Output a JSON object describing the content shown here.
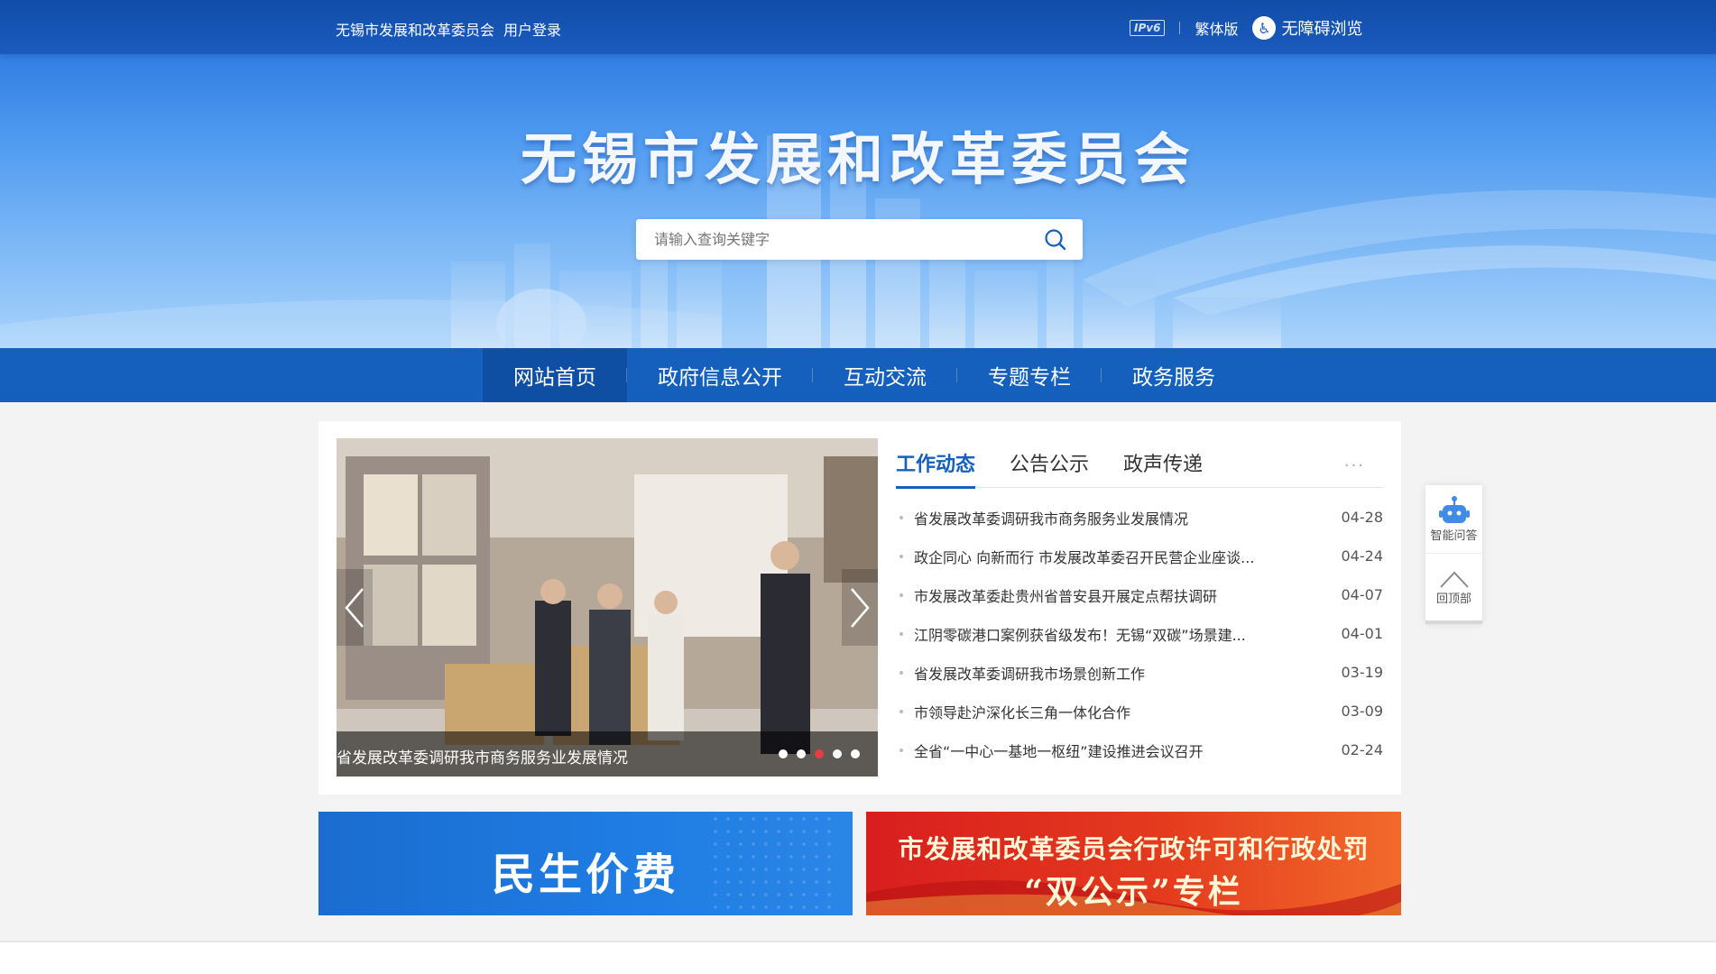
{
  "topbar": {
    "org_name": "无锡市发展和改革委员会",
    "login": "用户登录",
    "ipv6": "IPv6",
    "traditional": "繁体版",
    "accessibility": "无障碍浏览"
  },
  "header": {
    "site_title": "无锡市发展和改革委员会",
    "search_placeholder": "请输入查询关键字"
  },
  "nav": {
    "items": [
      {
        "label": "网站首页",
        "active": true
      },
      {
        "label": "政府信息公开"
      },
      {
        "label": "互动交流"
      },
      {
        "label": "专题专栏"
      },
      {
        "label": "政务服务"
      }
    ]
  },
  "carousel": {
    "caption": "省发展改革委调研我市商务服务业发展情况",
    "dots": 5,
    "active_dot": 3
  },
  "news": {
    "tabs": [
      {
        "label": "工作动态",
        "active": true
      },
      {
        "label": "公告公示"
      },
      {
        "label": "政声传递"
      }
    ],
    "more": "···",
    "items": [
      {
        "title": "省发展改革委调研我市商务服务业发展情况",
        "date": "04-28"
      },
      {
        "title": "政企同心 向新而行 市发展改革委召开民营企业座谈...",
        "date": "04-24"
      },
      {
        "title": "市发展改革委赴贵州省普安县开展定点帮扶调研",
        "date": "04-07"
      },
      {
        "title": "江阴零碳港口案例获省级发布！无锡“双碳”场景建...",
        "date": "04-01"
      },
      {
        "title": "省发展改革委调研我市场景创新工作",
        "date": "03-19"
      },
      {
        "title": "市领导赴沪深化长三角一体化合作",
        "date": "03-09"
      },
      {
        "title": "全省“一中心一基地一枢纽”建设推进会议召开",
        "date": "02-24"
      }
    ]
  },
  "side": {
    "ai_label": "智能问答",
    "top_label": "回顶部"
  },
  "banners": {
    "left": "民生价费",
    "right_line1": "市发展和改革委员会行政许可和行政处罚",
    "right_line2": "“双公示”专栏"
  },
  "colors": {
    "primary": "#1560bd",
    "active_dot": "#e53e3e",
    "banner_red": "#d81e1e"
  }
}
